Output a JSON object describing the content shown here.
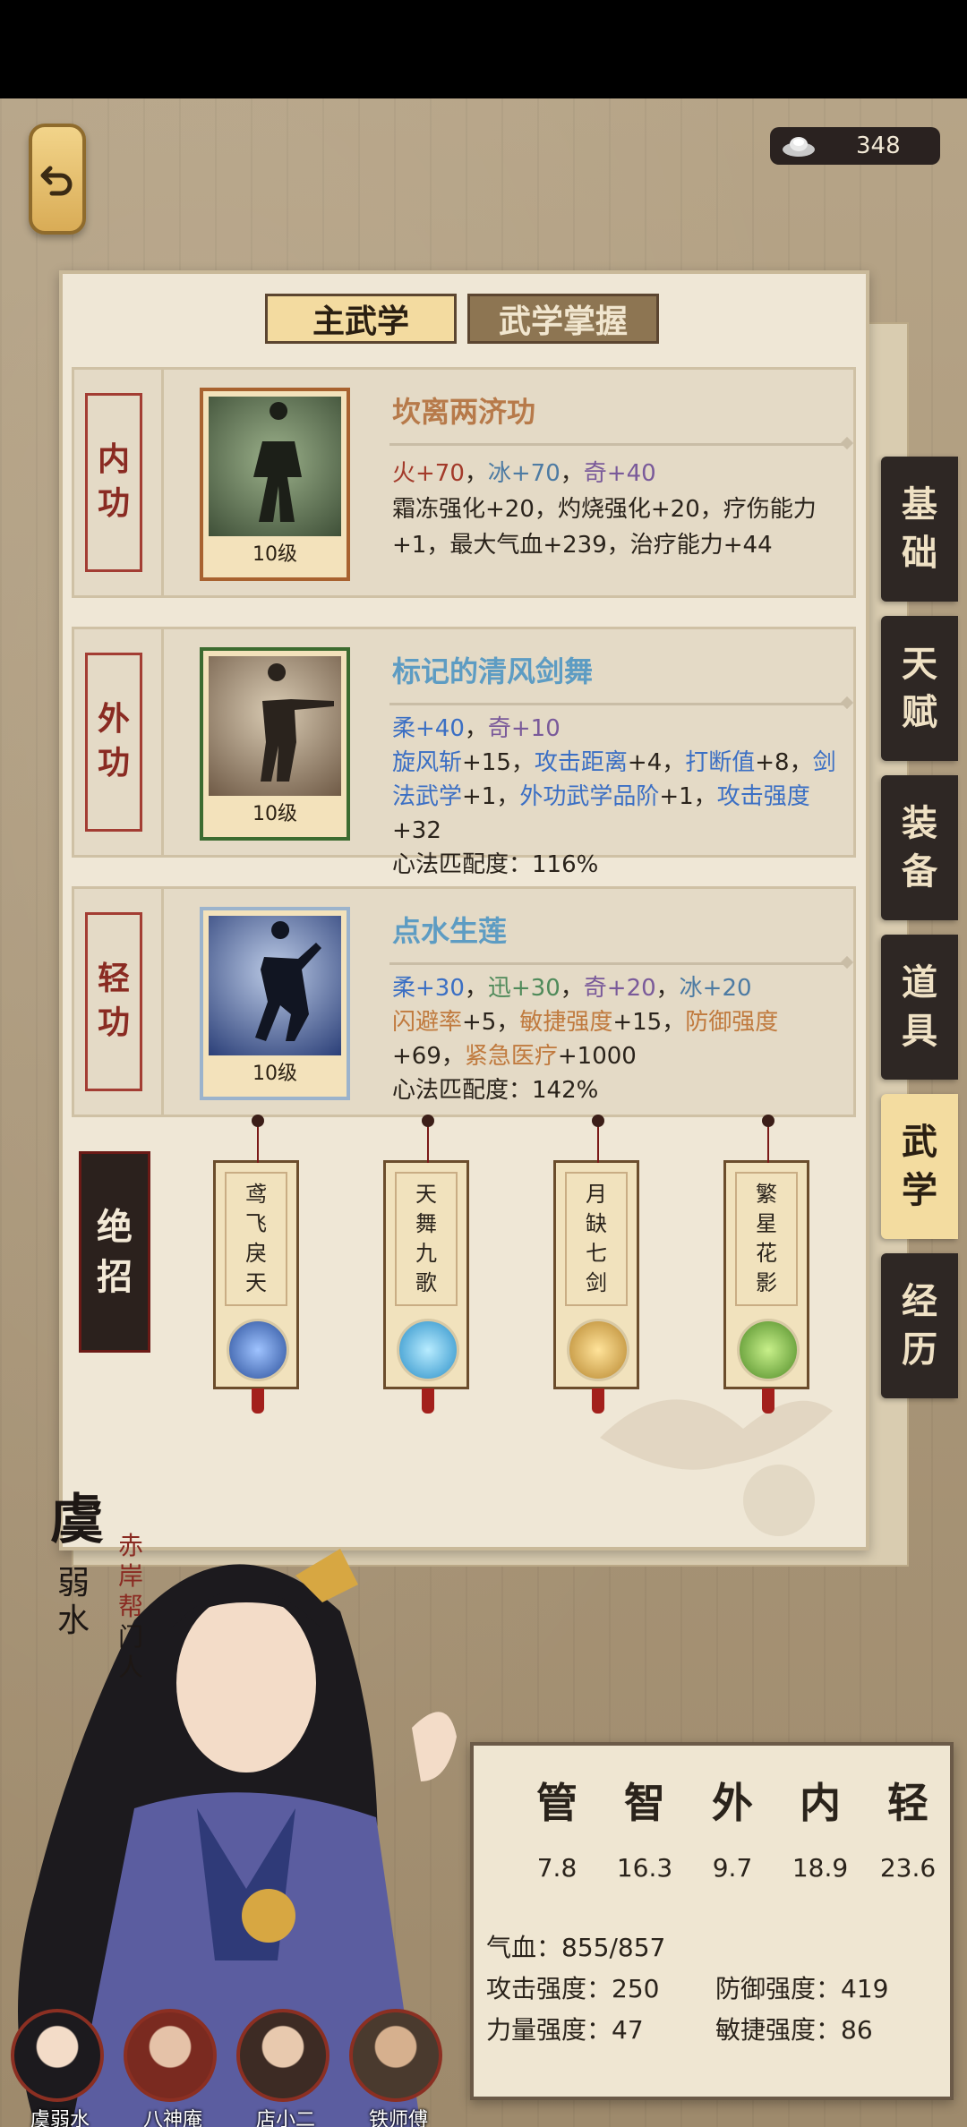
{
  "currency": {
    "icon": "silver-ingot-icon",
    "amount": "348"
  },
  "tabs": {
    "main": "主武学",
    "mastery": "武学掌握"
  },
  "skills": [
    {
      "slot": [
        "内",
        "功"
      ],
      "name": "坎离两济功",
      "name_color": "#b77a4a",
      "level": "10级",
      "stats_line1": [
        {
          "text": "火+70",
          "cls": "c-red"
        },
        {
          "text": "，",
          "cls": ""
        },
        {
          "text": "冰+70",
          "cls": "c-blue"
        },
        {
          "text": "，",
          "cls": ""
        },
        {
          "text": "奇+40",
          "cls": "c-purple"
        }
      ],
      "stats_rest": "霜冻强化+20，灼烧强化+20，疗伤能力+1，最大气血+239，治疗能力+44"
    },
    {
      "slot": [
        "外",
        "功"
      ],
      "name": "标记的清风剑舞",
      "name_color": "#5d9cc3",
      "level": "10级",
      "stats_line1": [
        {
          "text": "柔+40",
          "cls": "c-bright"
        },
        {
          "text": "，",
          "cls": ""
        },
        {
          "text": "奇+10",
          "cls": "c-purple"
        }
      ],
      "stats_line2": [
        {
          "text": "旋风斩",
          "cls": "c-bright"
        },
        {
          "text": "+15，",
          "cls": ""
        },
        {
          "text": "攻击距离",
          "cls": "c-bright"
        },
        {
          "text": "+4，",
          "cls": ""
        },
        {
          "text": "打断值",
          "cls": "c-bright"
        },
        {
          "text": "+8，",
          "cls": ""
        },
        {
          "text": "剑法武学",
          "cls": "c-bright"
        },
        {
          "text": "+1，",
          "cls": ""
        },
        {
          "text": "外功武学品阶",
          "cls": "c-bright"
        },
        {
          "text": "+1，",
          "cls": ""
        },
        {
          "text": "攻击强度",
          "cls": "c-bright"
        },
        {
          "text": "+32",
          "cls": ""
        }
      ],
      "match": "心法匹配度：116%"
    },
    {
      "slot": [
        "轻",
        "功"
      ],
      "name": "点水生莲",
      "name_color": "#5d9cc3",
      "level": "10级",
      "stats_line1": [
        {
          "text": "柔+30",
          "cls": "c-bright"
        },
        {
          "text": "，",
          "cls": ""
        },
        {
          "text": "迅+30",
          "cls": "c-green"
        },
        {
          "text": "，",
          "cls": ""
        },
        {
          "text": "奇+20",
          "cls": "c-purple"
        },
        {
          "text": "，",
          "cls": ""
        },
        {
          "text": "冰+20",
          "cls": "c-blue"
        }
      ],
      "stats_line2": [
        {
          "text": "闪避率",
          "cls": "c-orange"
        },
        {
          "text": "+5，",
          "cls": ""
        },
        {
          "text": "敏捷强度",
          "cls": "c-orange"
        },
        {
          "text": "+15，",
          "cls": ""
        },
        {
          "text": "防御强度",
          "cls": "c-orange"
        },
        {
          "text": "+69，",
          "cls": ""
        },
        {
          "text": "紧急医疗",
          "cls": "c-orange"
        },
        {
          "text": "+1000",
          "cls": ""
        }
      ],
      "match": "心法匹配度：142%"
    }
  ],
  "ultimate": {
    "label": [
      "绝",
      "招"
    ],
    "cards": [
      {
        "name": [
          "鸢",
          "飞",
          "戾",
          "天"
        ],
        "icon": "blade-icon",
        "orb": "#2a4f9a"
      },
      {
        "name": [
          "天",
          "舞",
          "九",
          "歌"
        ],
        "icon": "whirl-icon",
        "orb": "#2a8fc8"
      },
      {
        "name": [
          "月",
          "缺",
          "七",
          "剑"
        ],
        "icon": "moon-blade-icon",
        "orb": "#b7862e"
      },
      {
        "name": [
          "繁",
          "星",
          "花",
          "影"
        ],
        "icon": "spear-icon",
        "orb": "#4e8a26"
      }
    ]
  },
  "side_tabs": [
    {
      "label": [
        "基",
        "础"
      ],
      "active": false
    },
    {
      "label": [
        "天",
        "赋"
      ],
      "active": false
    },
    {
      "label": [
        "装",
        "备"
      ],
      "active": false
    },
    {
      "label": [
        "道",
        "具"
      ],
      "active": false
    },
    {
      "label": [
        "武",
        "学"
      ],
      "active": true
    },
    {
      "label": [
        "经",
        "历"
      ],
      "active": false
    }
  ],
  "character": {
    "surname": "虞",
    "given": [
      "弱",
      "水"
    ],
    "faction": [
      "赤",
      "岸",
      "帮"
    ],
    "title": [
      "门",
      "人"
    ]
  },
  "attributes": {
    "heads": [
      "管",
      "智",
      "外",
      "内",
      "轻"
    ],
    "values": [
      "7.8",
      "16.3",
      "9.7",
      "18.9",
      "23.6"
    ],
    "hp": "气血：855/857",
    "atk": "攻击强度：250",
    "def": "防御强度：419",
    "str": "力量强度：47",
    "agi": "敏捷强度：86"
  },
  "roster": [
    {
      "name": "虞弱水"
    },
    {
      "name": "八神庵"
    },
    {
      "name": "店小二"
    },
    {
      "name": "铁师傅"
    }
  ],
  "colors": {
    "accent_red": "#8a2b22",
    "gold": "#f3dba0",
    "dark": "#2e2724"
  }
}
